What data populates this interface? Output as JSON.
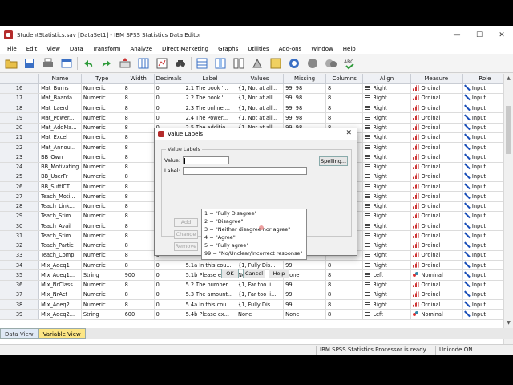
{
  "window": {
    "title": "StudentStatistics.sav [DataSet1] - IBM SPSS Statistics Data Editor",
    "minimize": "—",
    "maximize": "☐",
    "close": "✕"
  },
  "menu": [
    "File",
    "Edit",
    "View",
    "Data",
    "Transform",
    "Analyze",
    "Direct Marketing",
    "Graphs",
    "Utilities",
    "Add-ons",
    "Window",
    "Help"
  ],
  "toolbar_icons": [
    "open-icon",
    "save-icon",
    "print-icon",
    "recall-dialog-icon",
    "undo-icon",
    "redo-icon",
    "goto-case-icon",
    "goto-variable-icon",
    "variables-icon",
    "find-icon",
    "insert-cases-icon",
    "insert-variable-icon",
    "split-file-icon",
    "weight-cases-icon",
    "select-cases-icon",
    "value-labels-icon",
    "use-sets-icon",
    "show-all-icon",
    "spell-check-icon"
  ],
  "grid": {
    "headers": [
      "Name",
      "Type",
      "Width",
      "Decimals",
      "Label",
      "Values",
      "Missing",
      "Columns",
      "Align",
      "Measure",
      "Role"
    ],
    "rows": [
      {
        "num": "16",
        "name": "Mat_Burns",
        "type": "Numeric",
        "width": "8",
        "decimals": "0",
        "label": "2.1 The book '...",
        "values": "{1, Not at all...",
        "missing": "99, 98",
        "columns": "8",
        "align": "Right",
        "measure": "Ordinal",
        "role": "Input"
      },
      {
        "num": "17",
        "name": "Mat_Baarda",
        "type": "Numeric",
        "width": "8",
        "decimals": "0",
        "label": "2.2 The book '...",
        "values": "{1, Not at all...",
        "missing": "99, 98",
        "columns": "8",
        "align": "Right",
        "measure": "Ordinal",
        "role": "Input"
      },
      {
        "num": "18",
        "name": "Mat_Laerd",
        "type": "Numeric",
        "width": "8",
        "decimals": "0",
        "label": "2.3 The online ...",
        "values": "{1, Not at all...",
        "missing": "99, 98",
        "columns": "8",
        "align": "Right",
        "measure": "Ordinal",
        "role": "Input"
      },
      {
        "num": "19",
        "name": "Mat_Power...",
        "type": "Numeric",
        "width": "8",
        "decimals": "0",
        "label": "2.4 The Power...",
        "values": "{1, Not at all...",
        "missing": "99, 98",
        "columns": "8",
        "align": "Right",
        "measure": "Ordinal",
        "role": "Input"
      },
      {
        "num": "20",
        "name": "Mat_AddMa...",
        "type": "Numeric",
        "width": "8",
        "decimals": "0",
        "label": "2.5 The additio...",
        "values": "{1, Not at all...",
        "missing": "99, 98",
        "columns": "8",
        "align": "Right",
        "measure": "Ordinal",
        "role": "Input"
      },
      {
        "num": "21",
        "name": "Mat_Excel",
        "type": "Numeric",
        "width": "8",
        "decimals": "0",
        "label": "",
        "values": "",
        "missing": "",
        "columns": "",
        "align": "Right",
        "measure": "Ordinal",
        "role": "Input"
      },
      {
        "num": "22",
        "name": "Mat_Annou...",
        "type": "Numeric",
        "width": "8",
        "decimals": "0",
        "label": "",
        "values": "",
        "missing": "",
        "columns": "",
        "align": "Right",
        "measure": "Ordinal",
        "role": "Input"
      },
      {
        "num": "23",
        "name": "BB_Own",
        "type": "Numeric",
        "width": "8",
        "decimals": "0",
        "label": "",
        "values": "",
        "missing": "",
        "columns": "",
        "align": "Right",
        "measure": "Ordinal",
        "role": "Input"
      },
      {
        "num": "24",
        "name": "BB_Motivating",
        "type": "Numeric",
        "width": "8",
        "decimals": "0",
        "label": "",
        "values": "",
        "missing": "",
        "columns": "",
        "align": "Right",
        "measure": "Ordinal",
        "role": "Input"
      },
      {
        "num": "25",
        "name": "BB_UserFr",
        "type": "Numeric",
        "width": "8",
        "decimals": "0",
        "label": "",
        "values": "",
        "missing": "",
        "columns": "",
        "align": "Right",
        "measure": "Ordinal",
        "role": "Input"
      },
      {
        "num": "26",
        "name": "BB_SuffICT",
        "type": "Numeric",
        "width": "8",
        "decimals": "0",
        "label": "",
        "values": "",
        "missing": "",
        "columns": "",
        "align": "Right",
        "measure": "Ordinal",
        "role": "Input"
      },
      {
        "num": "27",
        "name": "Teach_Moti...",
        "type": "Numeric",
        "width": "8",
        "decimals": "0",
        "label": "",
        "values": "",
        "missing": "",
        "columns": "",
        "align": "Right",
        "measure": "Ordinal",
        "role": "Input"
      },
      {
        "num": "28",
        "name": "Teach_Link...",
        "type": "Numeric",
        "width": "8",
        "decimals": "0",
        "label": "",
        "values": "",
        "missing": "",
        "columns": "",
        "align": "Right",
        "measure": "Ordinal",
        "role": "Input"
      },
      {
        "num": "29",
        "name": "Teach_Stim...",
        "type": "Numeric",
        "width": "8",
        "decimals": "0",
        "label": "",
        "values": "",
        "missing": "",
        "columns": "",
        "align": "Right",
        "measure": "Ordinal",
        "role": "Input"
      },
      {
        "num": "30",
        "name": "Teach_Avail",
        "type": "Numeric",
        "width": "8",
        "decimals": "0",
        "label": "",
        "values": "",
        "missing": "",
        "columns": "",
        "align": "Right",
        "measure": "Ordinal",
        "role": "Input"
      },
      {
        "num": "31",
        "name": "Teach_Stim...",
        "type": "Numeric",
        "width": "8",
        "decimals": "0",
        "label": "",
        "values": "",
        "missing": "",
        "columns": "",
        "align": "Right",
        "measure": "Ordinal",
        "role": "Input"
      },
      {
        "num": "32",
        "name": "Teach_Partic",
        "type": "Numeric",
        "width": "8",
        "decimals": "0",
        "label": "",
        "values": "",
        "missing": "",
        "columns": "",
        "align": "Right",
        "measure": "Ordinal",
        "role": "Input"
      },
      {
        "num": "33",
        "name": "Teach_Comp",
        "type": "Numeric",
        "width": "8",
        "decimals": "0",
        "label": "",
        "values": "",
        "missing": "",
        "columns": "",
        "align": "Right",
        "measure": "Ordinal",
        "role": "Input"
      },
      {
        "num": "34",
        "name": "Mix_Adeq1",
        "type": "Numeric",
        "width": "8",
        "decimals": "0",
        "label": "5.1a In this cou...",
        "values": "{1, Fully Dis...",
        "missing": "99",
        "columns": "8",
        "align": "Right",
        "measure": "Ordinal",
        "role": "Input"
      },
      {
        "num": "35",
        "name": "Mix_Adeq1...",
        "type": "String",
        "width": "900",
        "decimals": "0",
        "label": "5.1b Please ex...",
        "values": "None",
        "missing": "None",
        "columns": "8",
        "align": "Left",
        "measure": "Nominal",
        "role": "Input"
      },
      {
        "num": "36",
        "name": "Mix_NrClass",
        "type": "Numeric",
        "width": "8",
        "decimals": "0",
        "label": "5.2 The number...",
        "values": "{1, Far too li...",
        "missing": "99",
        "columns": "8",
        "align": "Right",
        "measure": "Ordinal",
        "role": "Input"
      },
      {
        "num": "37",
        "name": "Mix_NrAct",
        "type": "Numeric",
        "width": "8",
        "decimals": "0",
        "label": "5.3 The amount...",
        "values": "{1, Far too li...",
        "missing": "99",
        "columns": "8",
        "align": "Right",
        "measure": "Ordinal",
        "role": "Input"
      },
      {
        "num": "38",
        "name": "Mix_Adeq2",
        "type": "Numeric",
        "width": "8",
        "decimals": "0",
        "label": "5.4a In this cou...",
        "values": "{1, Fully Dis...",
        "missing": "99",
        "columns": "8",
        "align": "Right",
        "measure": "Ordinal",
        "role": "Input"
      },
      {
        "num": "39",
        "name": "Mix_Adeq2...",
        "type": "String",
        "width": "600",
        "decimals": "0",
        "label": "5.4b Please ex...",
        "values": "None",
        "missing": "None",
        "columns": "8",
        "align": "Left",
        "measure": "Nominal",
        "role": "Input"
      }
    ]
  },
  "tabs": {
    "data_view": "Data View",
    "variable_view": "Variable View"
  },
  "status": {
    "processor": "IBM SPSS Statistics Processor is ready",
    "unicode": "Unicode:ON"
  },
  "dialog": {
    "title": "Value Labels",
    "group_label": "Value Labels",
    "value_label": "Value:",
    "label_label": "Label:",
    "value_input": "",
    "label_input": "",
    "spelling": "Spelling...",
    "add": "Add",
    "change": "Change",
    "remove": "Remove",
    "items": [
      "1 = \"Fully Disagree\"",
      "2 = \"Disagree\"",
      "3 = \"Neither disagree nor agree\"",
      "4 = \"Agree\"",
      "5 = \"Fully agree\"",
      "99 = \"No/Unclear/Incorrect response\""
    ],
    "ok": "OK",
    "cancel": "Cancel",
    "help": "Help",
    "close": "✕"
  }
}
